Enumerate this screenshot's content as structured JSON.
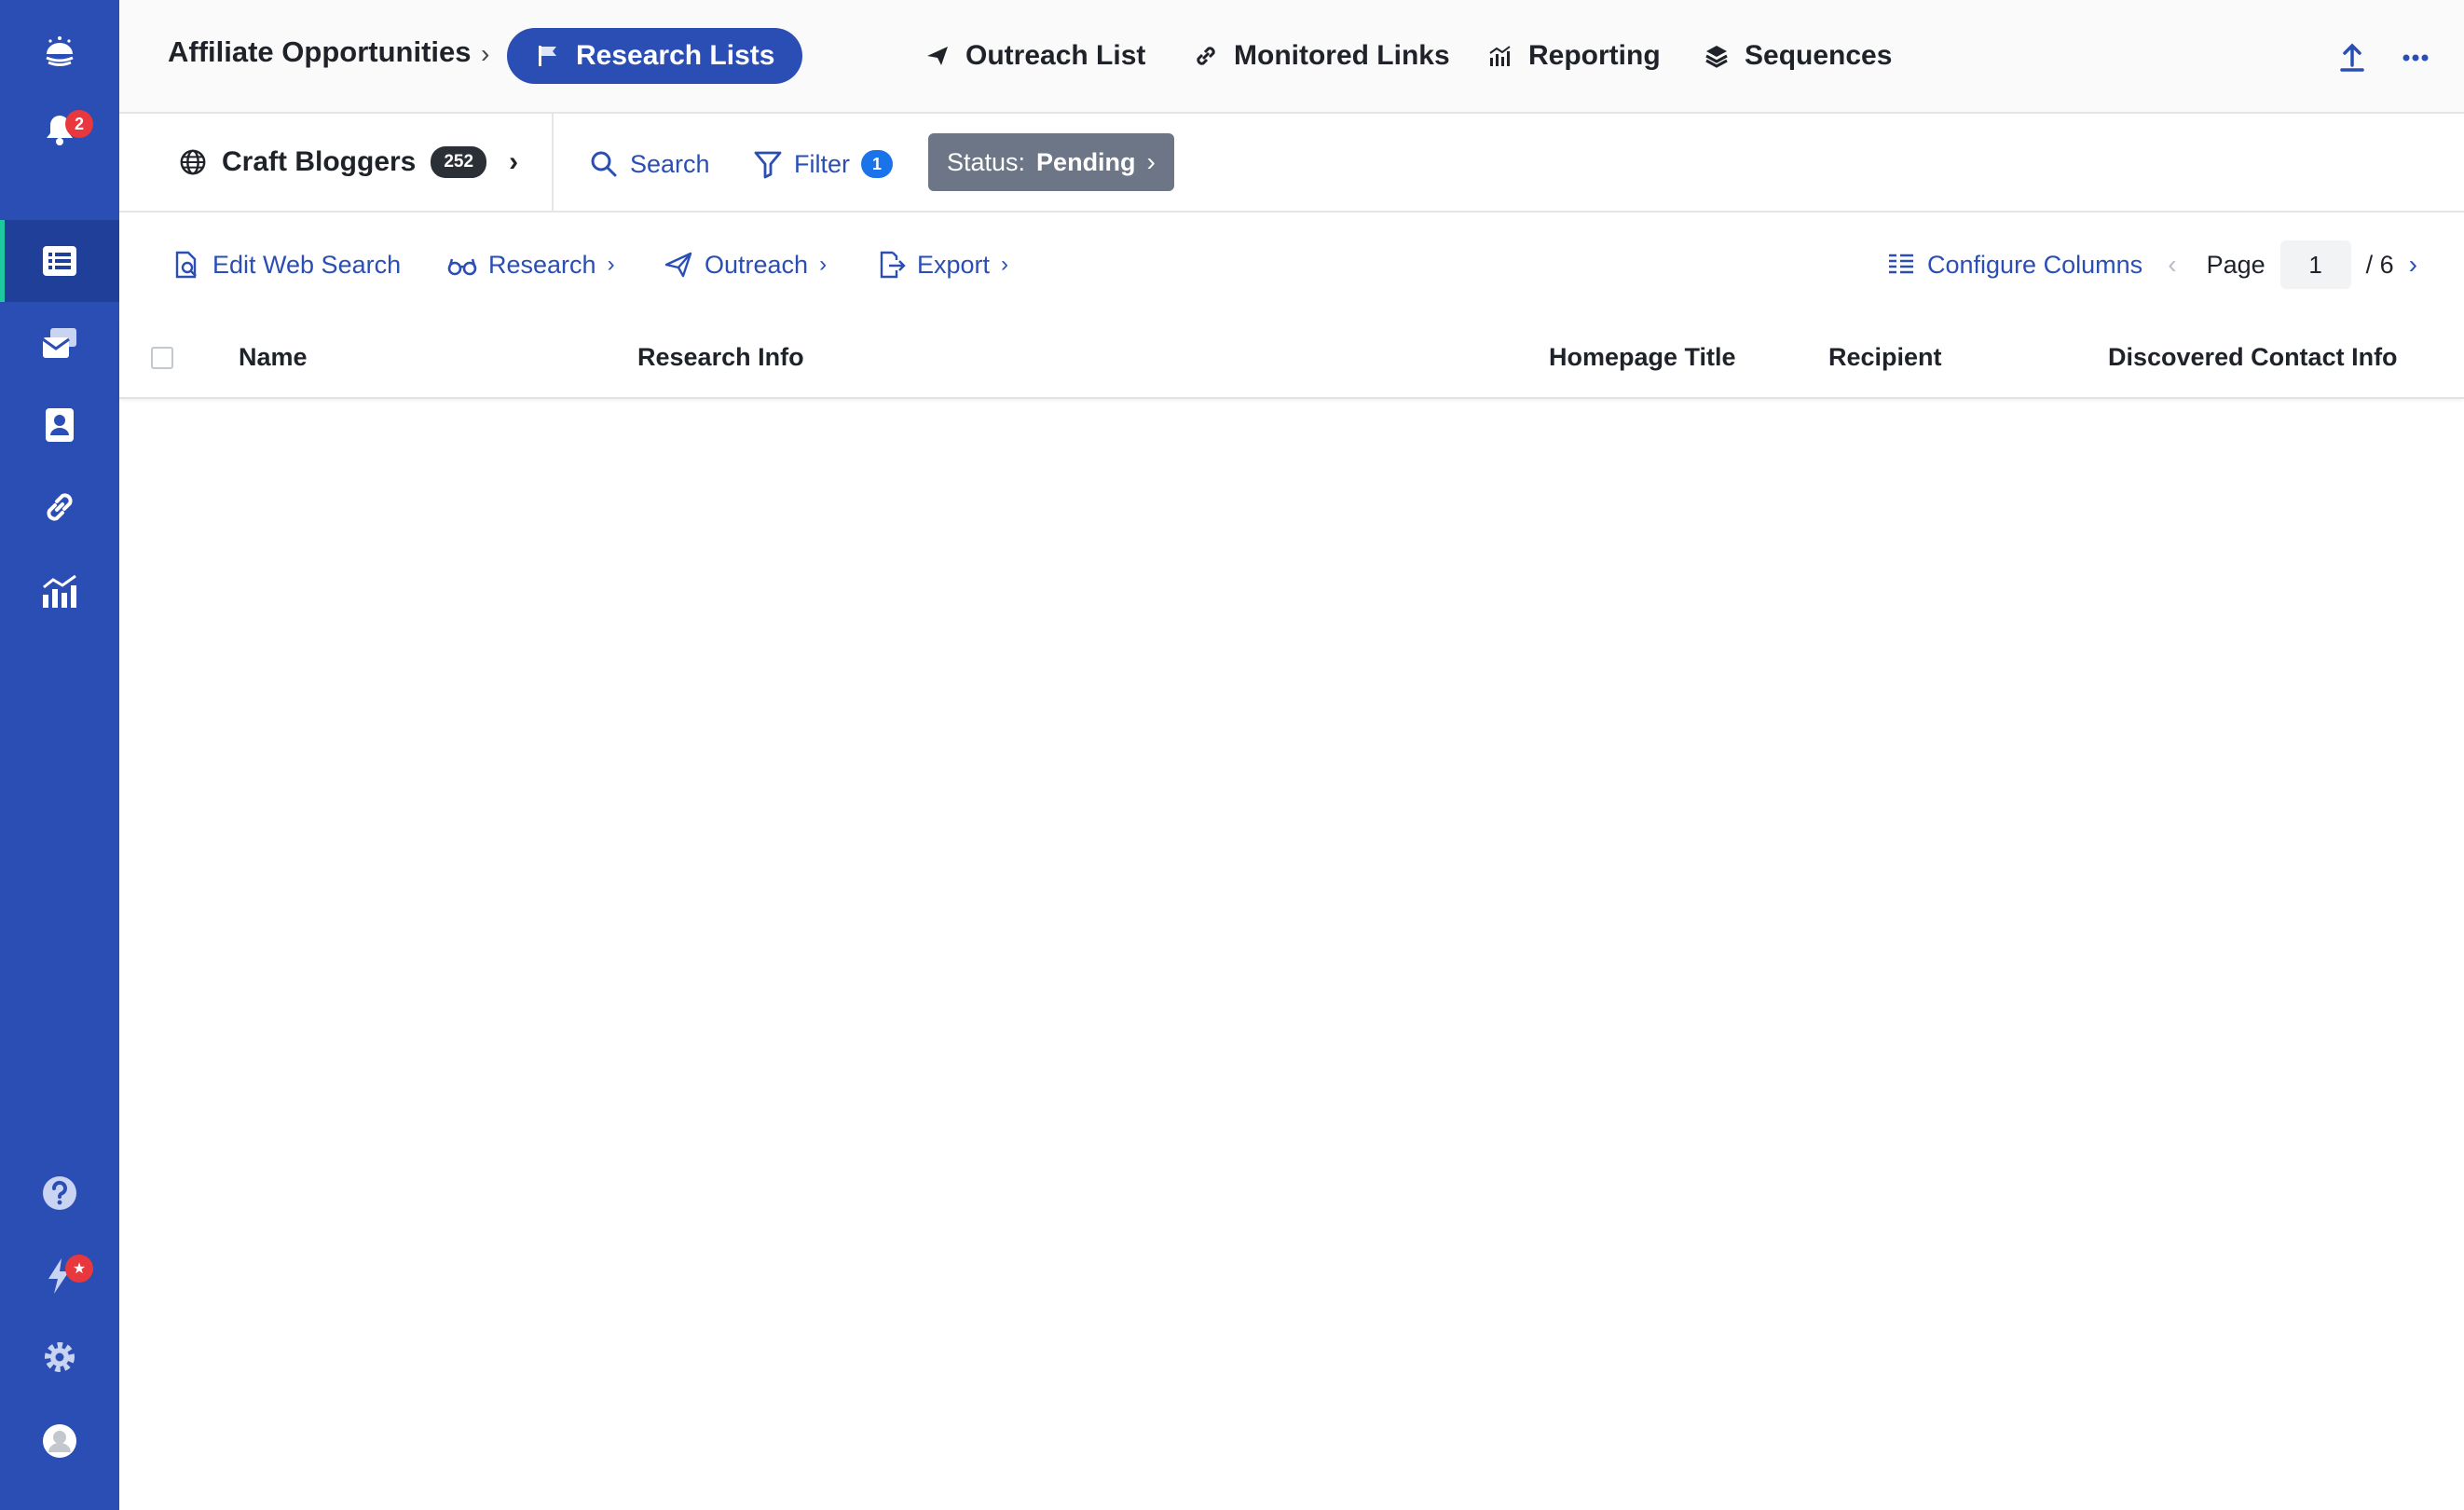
{
  "sidebar": {
    "notification_count": "2",
    "items": [
      {
        "icon": "logo-icon"
      },
      {
        "icon": "bell-icon"
      },
      {
        "icon": "research-list-icon"
      },
      {
        "icon": "outreach-mail-icon"
      },
      {
        "icon": "contacts-icon"
      },
      {
        "icon": "link-icon"
      },
      {
        "icon": "reporting-chart-icon"
      },
      {
        "icon": "help-icon"
      },
      {
        "icon": "whats-new-icon"
      },
      {
        "icon": "settings-gear-icon"
      },
      {
        "icon": "user-avatar-icon"
      }
    ],
    "accent_color": "#2a4eb4",
    "active_indicator_color": "#1ec9a0"
  },
  "header": {
    "breadcrumb": "Affiliate Opportunities",
    "tabs": [
      {
        "label": "Research Lists",
        "icon": "flag-icon",
        "active": true
      },
      {
        "label": "Outreach List",
        "icon": "paper-plane-icon",
        "active": false
      },
      {
        "label": "Monitored Links",
        "icon": "link-icon",
        "active": false
      },
      {
        "label": "Reporting",
        "icon": "bar-chart-icon",
        "active": false
      },
      {
        "label": "Sequences",
        "icon": "layers-icon",
        "active": false
      }
    ]
  },
  "subbar": {
    "list_name": "Craft Bloggers",
    "list_count": "252",
    "search_label": "Search",
    "filter_label": "Filter",
    "filter_count": "1",
    "status_prefix": "Status:",
    "status_value": "Pending"
  },
  "toolbar": {
    "edit_web_search": "Edit Web Search",
    "research": "Research",
    "outreach": "Outreach",
    "export": "Export",
    "configure_columns": "Configure Columns",
    "page_label": "Page",
    "page_value": "1",
    "page_total": "/ 6"
  },
  "table": {
    "columns": [
      "Name",
      "Research Info",
      "Homepage Title",
      "Recipient",
      "Discovered Contact Info"
    ]
  }
}
